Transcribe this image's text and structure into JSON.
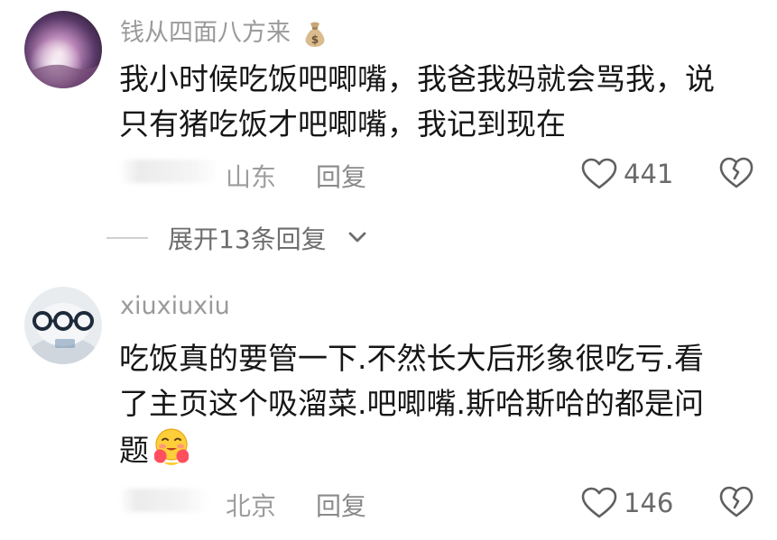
{
  "comments": [
    {
      "username": "钱从四面八方来",
      "username_emoji": "money-bag-emoji",
      "lines": [
        "我小时候吃饭吧唧嘴，我爸我妈就会骂我，说",
        "只有猪吃饭才吧唧嘴，我记到现在"
      ],
      "location": "山东",
      "reply_label": "回复",
      "likes": "441"
    },
    {
      "username": "xiuxiuxiu",
      "lines": [
        "吃饭真的要管一下.不然长大后形象很吃亏.看",
        "了主页这个吸溜菜.吧唧嘴.斯哈斯哈的都是问",
        "题"
      ],
      "trailing_emoji": "hug-emoji",
      "location": "北京",
      "reply_label": "回复",
      "likes": "146"
    }
  ],
  "expand_replies": {
    "label": "展开13条回复"
  },
  "colors": {
    "text_primary": "#161616",
    "text_secondary": "#9a9a9a",
    "divider": "#d0d0d0"
  }
}
